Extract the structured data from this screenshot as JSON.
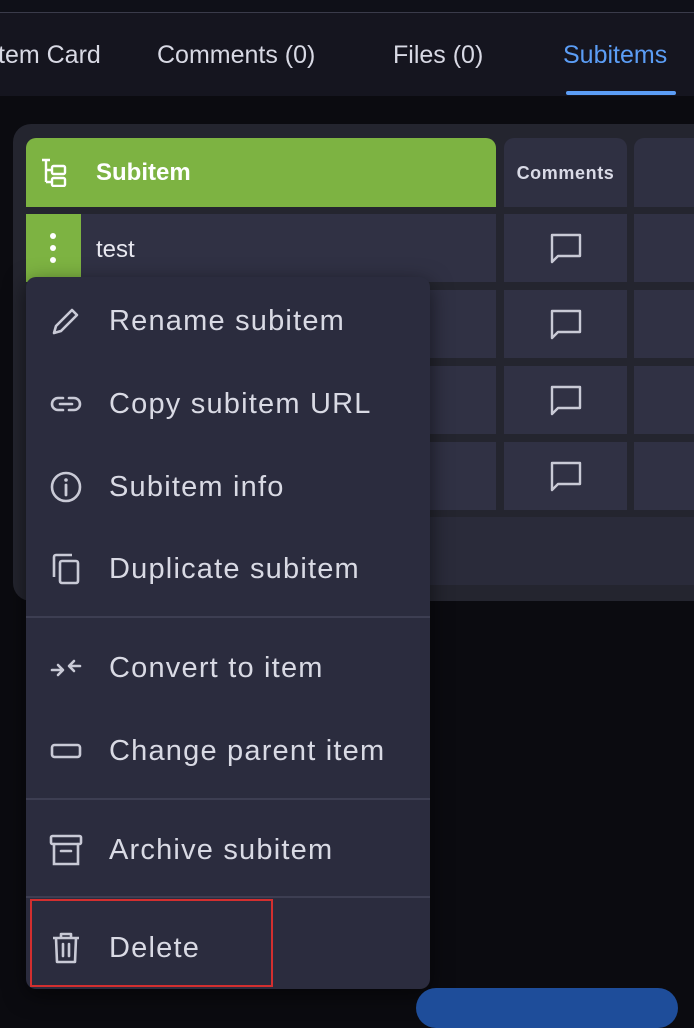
{
  "tabs": {
    "item_card": "tem Card",
    "comments": "Comments (0)",
    "files": "Files (0)",
    "subitems": "Subitems"
  },
  "table": {
    "header_name": "Subitem",
    "header_comments": "Comments",
    "rows": [
      {
        "name": "test"
      }
    ]
  },
  "context_menu": {
    "rename": "Rename subitem",
    "copy_url": "Copy subitem URL",
    "info": "Subitem info",
    "duplicate": "Duplicate subitem",
    "convert": "Convert to item",
    "change_parent": "Change parent item",
    "archive": "Archive subitem",
    "delete": "Delete"
  },
  "colors": {
    "accent": "#5b9df5",
    "subitem_green": "#7db342",
    "menu_bg": "#2b2c3e",
    "highlight": "#d32f2f"
  }
}
